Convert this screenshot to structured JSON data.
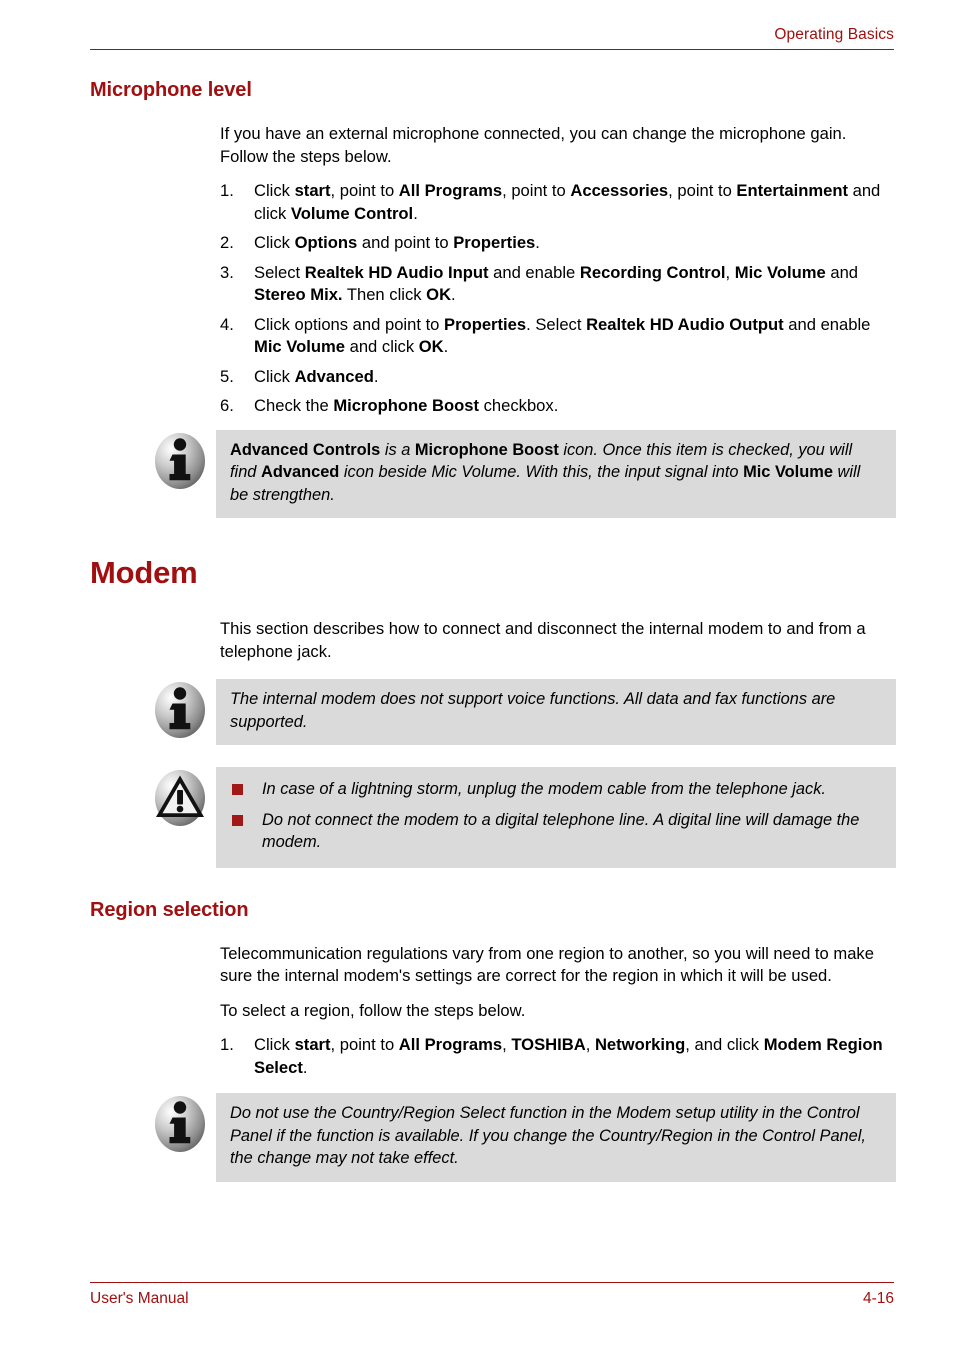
{
  "header": {
    "title": "Operating Basics",
    "rule_color": "#a01010"
  },
  "sections": {
    "microphone": {
      "heading": "Microphone level",
      "intro": "If you have an external microphone connected, you can change the microphone gain. Follow the steps below.",
      "steps": [
        {
          "num": "1.",
          "html": "Click <b>start</b>, point to <b>All Programs</b>, point to <b>Accessories</b>, point to <b>Entertainment</b> and click <b>Volume Control</b>."
        },
        {
          "num": "2.",
          "html": "Click <b>Options</b> and point to <b>Properties</b>."
        },
        {
          "num": "3.",
          "html": "Select <b>Realtek HD Audio Input</b> and enable <b>Recording Control</b>, <b>Mic Volume</b> and <b>Stereo Mix.</b> Then click <b>OK</b>."
        },
        {
          "num": "4.",
          "html": "Click options and point to <b>Properties</b>. Select <b>Realtek HD Audio Output</b> and enable <b>Mic Volume</b> and click <b>OK</b>."
        },
        {
          "num": "5.",
          "html": "Click <b>Advanced</b>."
        },
        {
          "num": "6.",
          "html": "Check the <b>Microphone Boost</b> checkbox."
        }
      ],
      "note": {
        "icon": "info-icon",
        "html": "<b>Advanced Controls</b> is a <b>Microphone Boost</b> icon. Once this item is checked, you will find <b>Advanced</b> icon beside Mic Volume. With this, the input signal into <b>Mic Volume</b> will be strengthen."
      }
    },
    "modem": {
      "heading": "Modem",
      "intro": "This section describes how to connect and disconnect the internal modem to and from a telephone jack.",
      "note": {
        "icon": "info-icon",
        "html": "The internal modem does not support voice functions. All data and fax functions are supported."
      },
      "caution": {
        "icon": "warning-icon",
        "bullet_color": "#a01818",
        "items": [
          "In case of a lightning storm, unplug the modem cable from the telephone jack.",
          "Do not connect the modem to a digital telephone line. A digital line will damage the modem."
        ]
      }
    },
    "region": {
      "heading": "Region selection",
      "para1": "Telecommunication regulations vary from one region to another, so you will need to make sure the internal modem's settings are correct for the region in which it will be used.",
      "para2": "To select a region, follow the steps below.",
      "steps": [
        {
          "num": "1.",
          "html": "Click <b>start</b>, point to <b>All Programs</b>, <b>TOSHIBA</b>, <b>Networking</b>, and click <b>Modem Region Select</b>."
        }
      ],
      "note": {
        "icon": "info-icon",
        "html": "Do not use the Country/Region Select function in the Modem setup utility in the Control Panel if the function is available. If you change the Country/Region in the Control Panel, the change may not take effect."
      }
    }
  },
  "footer": {
    "left": "User's Manual",
    "right": "4-16"
  }
}
